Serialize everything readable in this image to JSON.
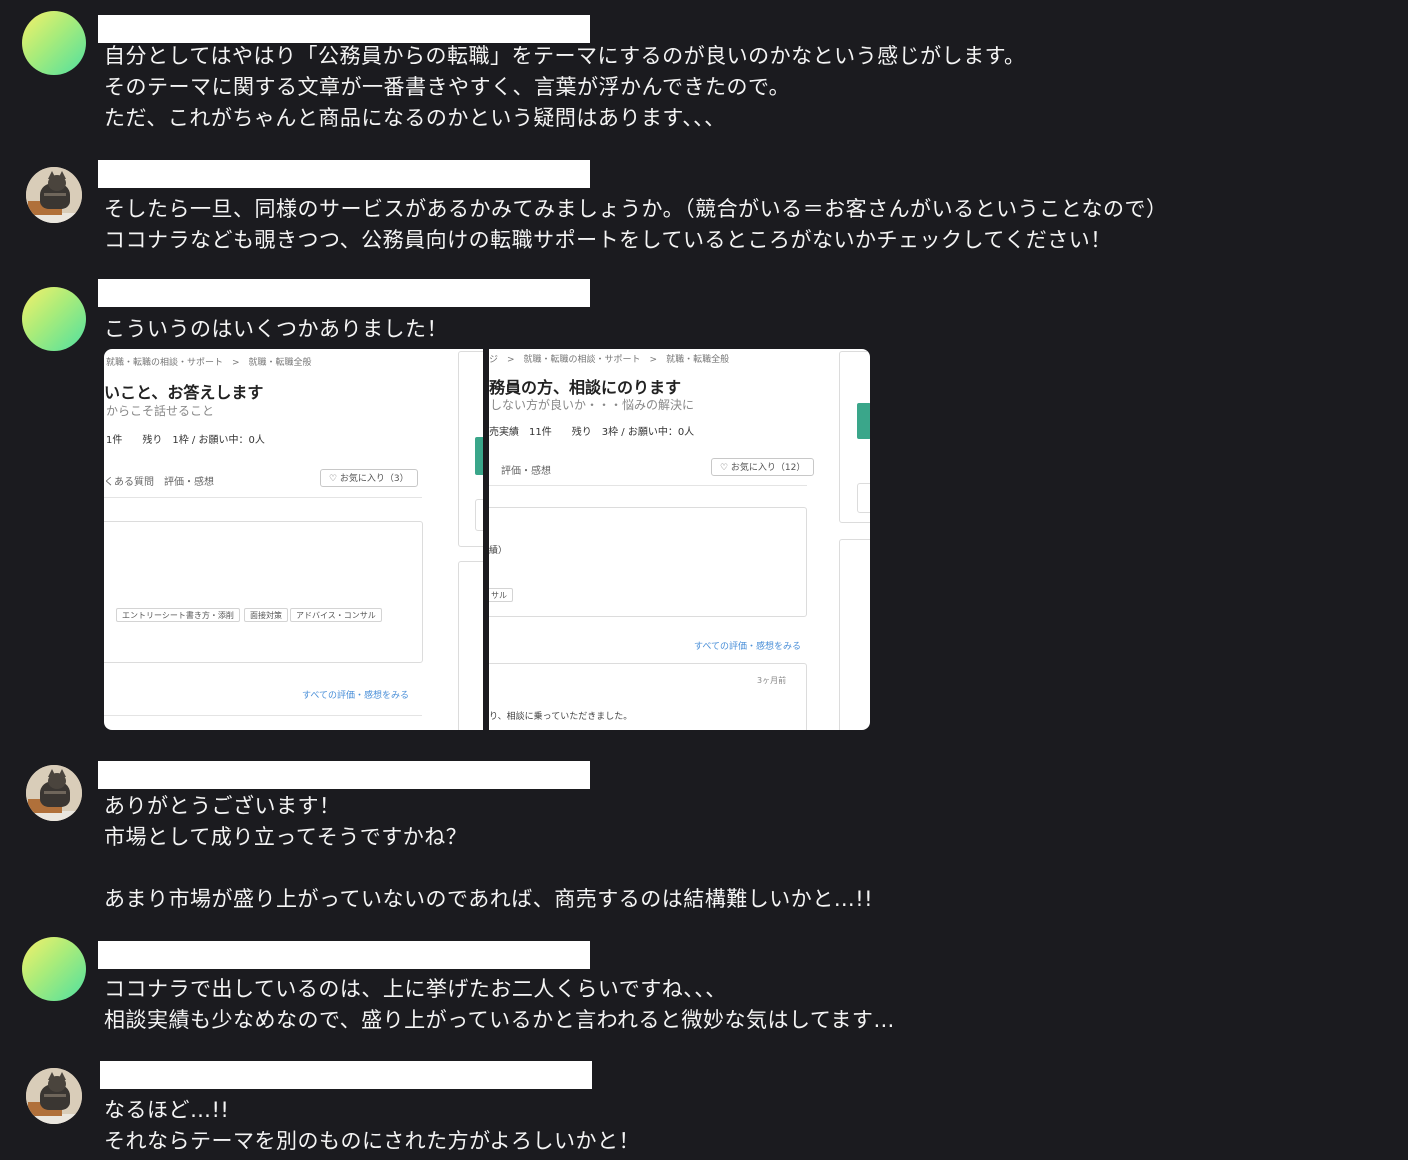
{
  "messages": [
    {
      "id": "m1",
      "avatar": "gradient-avatar",
      "lines": "自分としてはやはり「公務員からの転職」をテーマにするのが良いのかなという感じがします。\nそのテーマに関する文章が一番書きやすく、言葉が浮かんできたので。\nただ、これがちゃんと商品になるのかという疑問はあります、、、"
    },
    {
      "id": "m2",
      "avatar": "cat-avatar",
      "lines": "そしたら一旦、同様のサービスがあるかみてみましょうか。（競合がいる＝お客さんがいるということなので）\nココナラなども覗きつつ、公務員向けの転職サポートをしているところがないかチェックしてください！"
    },
    {
      "id": "m3",
      "avatar": "gradient-avatar",
      "lines": "こういうのはいくつかありました！"
    },
    {
      "id": "m4",
      "avatar": "cat-avatar",
      "lines": "ありがとうございます！\n市場として成り立ってそうですかね？\n\nあまり市場が盛り上がっていないのであれば、商売するのは結構難しいかと…!!"
    },
    {
      "id": "m5",
      "avatar": "gradient-avatar",
      "lines": "ココナラで出しているのは、上に挙げたお二人くらいですね、、、\n相談実績も少なめなので、盛り上がっているかと言われると微妙な気はしてます…"
    },
    {
      "id": "m6",
      "avatar": "cat-avatar",
      "lines": "なるほど…!!\nそれならテーマを別のものにされた方がよろしいかと！"
    }
  ],
  "screenshot_left": {
    "crumb": "就職・転職の相談・サポート　>　就職・転職全般",
    "title": "いこと、お答えします",
    "subtitle": "からこそ話せること",
    "stats": "1件　　残り　1枠 / お願い中：0人",
    "tabs": "くある質問　評価・感想",
    "fav": "♡ お気に入り（3）",
    "tags": [
      "エントリーシート書き方・添削",
      "面接対策",
      "アドバイス・コンサル"
    ],
    "link": "すべての評価・感想をみる"
  },
  "screenshot_right": {
    "crumb": "ジ　>　就職・転職の相談・サポート　>　就職・転職全般",
    "title": "務員の方、相談にのります",
    "subtitle": "しない方が良いか・・・悩みの解決に",
    "stats": "売実績　11件　　残り　3枠 / お願い中：0人",
    "tabs": "評価・感想",
    "fav": "♡ お気に入り（12）",
    "snippet1": "績）",
    "snippet2": "サル",
    "link": "すべての評価・感想をみる",
    "date": "3ヶ月前",
    "review": "り、相談に乗っていただきました。"
  }
}
